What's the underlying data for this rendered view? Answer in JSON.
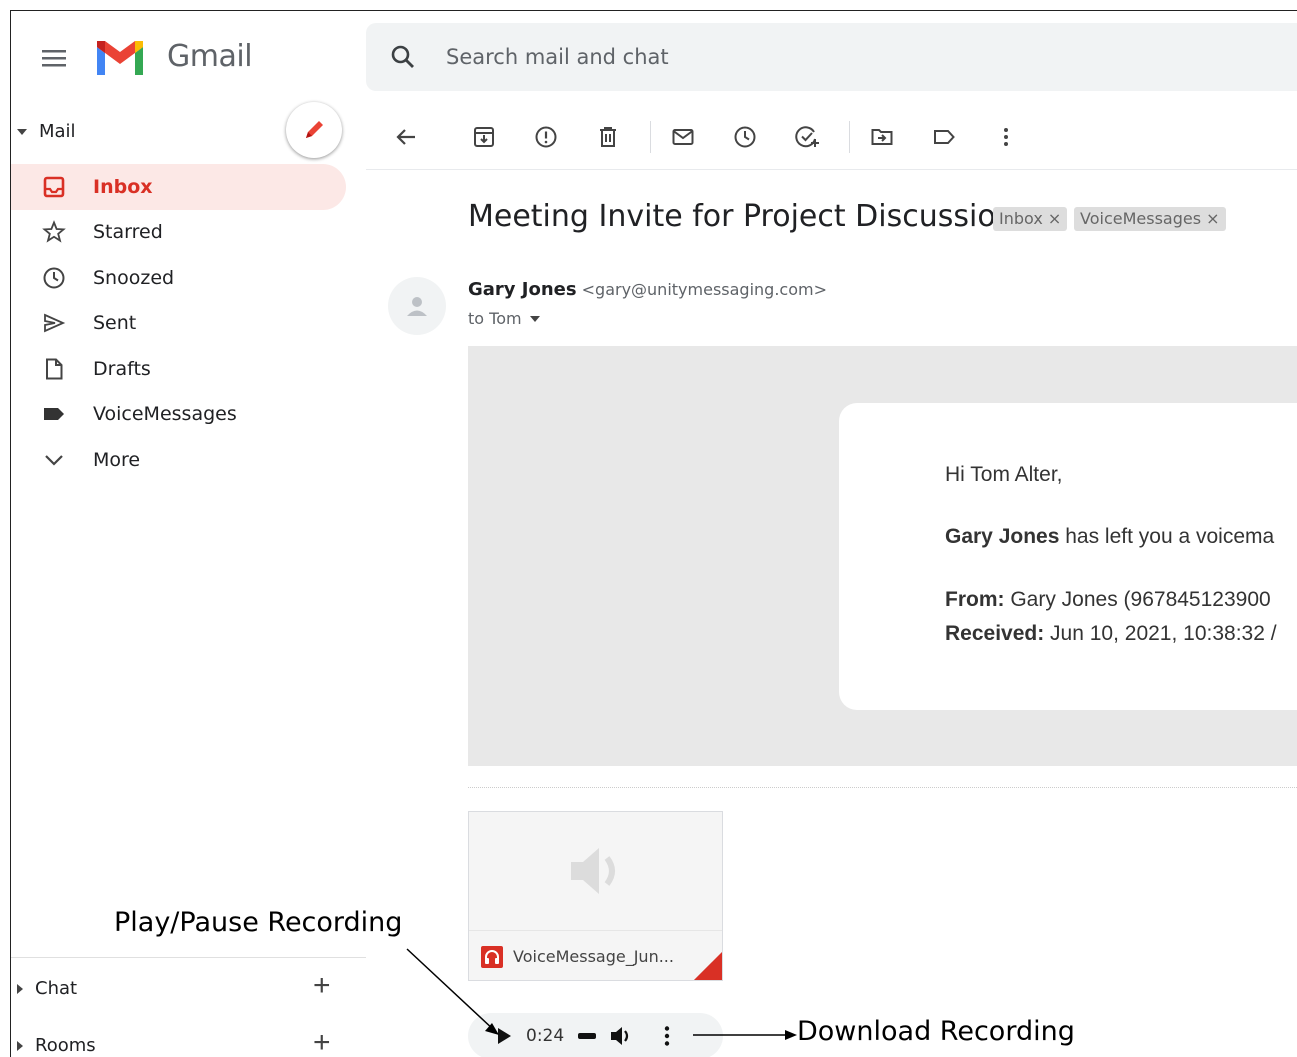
{
  "app": {
    "brand": "Gmail"
  },
  "search": {
    "placeholder": "Search mail and chat"
  },
  "sidebar": {
    "mail_section": "Mail",
    "items": [
      {
        "label": "Inbox",
        "icon": "inbox-icon",
        "active": true
      },
      {
        "label": "Starred",
        "icon": "star-icon"
      },
      {
        "label": "Snoozed",
        "icon": "clock-icon"
      },
      {
        "label": "Sent",
        "icon": "send-icon"
      },
      {
        "label": "Drafts",
        "icon": "draft-icon"
      },
      {
        "label": "VoiceMessages",
        "icon": "label-icon"
      },
      {
        "label": "More",
        "icon": "chevron-down-icon"
      }
    ],
    "chat_section": "Chat",
    "rooms_section": "Rooms"
  },
  "message": {
    "subject": "Meeting Invite for Project Discussion",
    "labels": [
      "Inbox ×",
      "VoiceMessages ×"
    ],
    "sender_name": "Gary Jones",
    "sender_email": "<gary@unitymessaging.com>",
    "to": "to Tom",
    "greeting": "Hi Tom Alter,",
    "line1_bold": "Gary Jones",
    "line1_rest": " has left you a voicema",
    "from_label": "From:",
    "from_value": " Gary Jones (967845123900",
    "received_label": "Received:",
    "received_value": " Jun 10, 2021, 10:38:32 /"
  },
  "attachment": {
    "name": "VoiceMessage_Jun..."
  },
  "player": {
    "time": "0:24"
  },
  "annotations": {
    "play_pause": "Play/Pause Recording",
    "download": "Download Recording"
  },
  "colors": {
    "accent": "#d93025",
    "active_bg": "#fce8e6"
  }
}
